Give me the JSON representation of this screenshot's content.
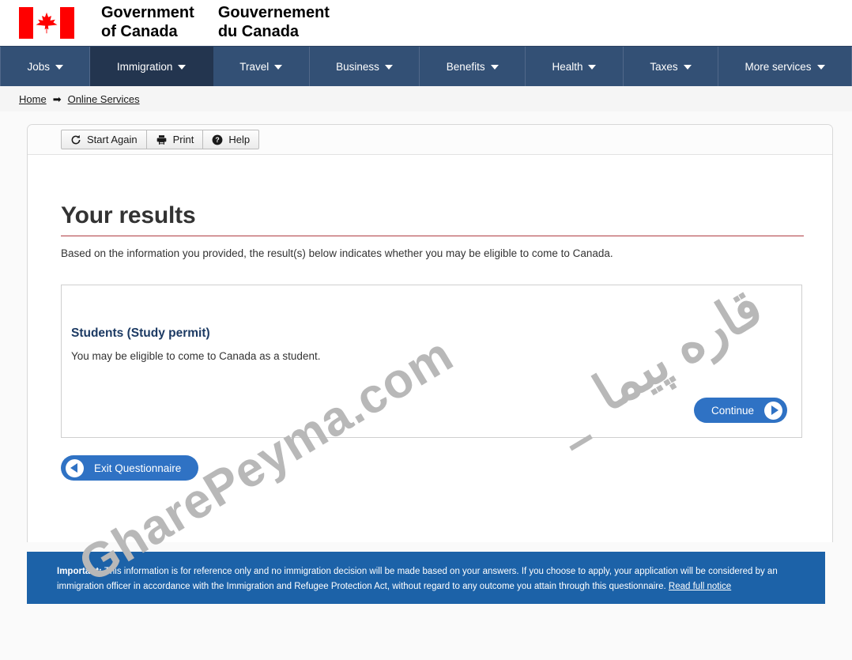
{
  "header": {
    "flag_alt": "canada-flag",
    "wordmark_en": "Government\nof Canada",
    "wordmark_fr": "Gouvernement\ndu Canada"
  },
  "mainnav": {
    "items": [
      {
        "label": "Jobs",
        "active": false
      },
      {
        "label": "Immigration",
        "active": true
      },
      {
        "label": "Travel",
        "active": false
      },
      {
        "label": "Business",
        "active": false
      },
      {
        "label": "Benefits",
        "active": false
      },
      {
        "label": "Health",
        "active": false
      },
      {
        "label": "Taxes",
        "active": false
      },
      {
        "label": "More services",
        "active": false
      }
    ]
  },
  "breadcrumb": {
    "home": "Home",
    "arrow": "➡",
    "current": "Online Services"
  },
  "toolbar": {
    "start_again_label": "Start Again",
    "print_label": "Print",
    "help_label": "Help"
  },
  "main": {
    "title": "Your results",
    "lede": "Based on the information you provided, the result(s) below indicates whether you may be eligible to come to Canada.",
    "result": {
      "heading": "Students (Study permit)",
      "body": "You may be eligible to come to Canada as a student."
    },
    "continue_label": "Continue",
    "exit_label": "Exit Questionnaire"
  },
  "notice": {
    "important_label": "Important:",
    "text": " This information is for reference only and no immigration decision will be made based on your answers. If you choose to apply, your application will be considered by an immigration officer in accordance with the Immigration and Refugee Protection Act, without regard to any outcome you attain through this questionnaire. ",
    "link_label": "Read full notice"
  },
  "watermark": {
    "latin": "GharePeyma.com",
    "persian": "قاره پیما",
    "dash": "–"
  },
  "colors": {
    "nav_bg": "#335075",
    "nav_active": "#23354f",
    "accent_red": "#af3c43",
    "link_blue": "#1c3a63",
    "button_blue": "#2f72c4",
    "notice_blue": "#1c62a8",
    "flag_red": "#ff0000"
  }
}
